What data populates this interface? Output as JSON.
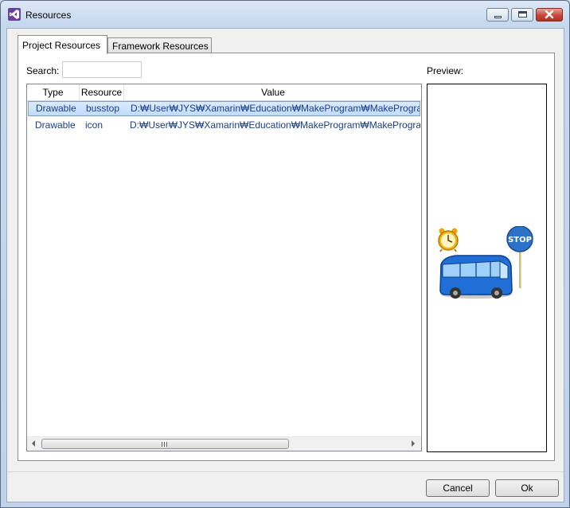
{
  "window": {
    "title": "Resources"
  },
  "tabs": [
    {
      "label": "Project Resources",
      "active": true
    },
    {
      "label": "Framework Resources",
      "active": false
    }
  ],
  "search": {
    "label": "Search:",
    "value": ""
  },
  "table": {
    "columns": [
      "Type",
      "Resource",
      "Value"
    ],
    "rows": [
      {
        "type": "Drawable",
        "resource": "busstop",
        "value": "D:₩User₩JYS₩Xamarin₩Education₩MakeProgram₩MakeProgram₩",
        "selected": true
      },
      {
        "type": "Drawable",
        "resource": "icon",
        "value": "D:₩User₩JYS₩Xamarin₩Education₩MakeProgram₩MakeProgram₩",
        "selected": false
      }
    ]
  },
  "preview": {
    "label": "Preview:",
    "image": "busstop-preview-image",
    "sign_text": "STOP"
  },
  "buttons": {
    "cancel": "Cancel",
    "ok": "Ok"
  },
  "colors": {
    "selection": "#c1dbfc",
    "row_text": "#1a3e8f",
    "bus_blue": "#1f6fd6"
  }
}
